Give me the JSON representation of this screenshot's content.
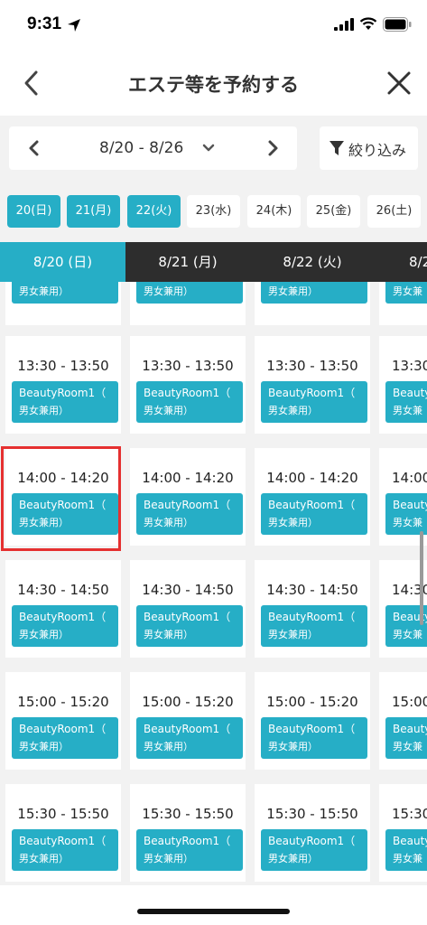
{
  "status_bar": {
    "time": "9:31"
  },
  "header": {
    "title": "エステ等を予約する"
  },
  "week_nav": {
    "range": "8/20 - 8/26"
  },
  "filter": {
    "label": "絞り込み"
  },
  "day_chips": [
    {
      "label": "20(日)",
      "selected": true
    },
    {
      "label": "21(月)",
      "selected": true
    },
    {
      "label": "22(火)",
      "selected": true
    },
    {
      "label": "23(水)",
      "selected": false
    },
    {
      "label": "24(木)",
      "selected": false
    },
    {
      "label": "25(金)",
      "selected": false
    },
    {
      "label": "26(土)",
      "selected": false
    }
  ],
  "columns": [
    {
      "label": "8/20 (日)",
      "active": true
    },
    {
      "label": "8/21 (月)",
      "active": false
    },
    {
      "label": "8/22 (火)",
      "active": false
    },
    {
      "label": "8/2",
      "active": false
    }
  ],
  "room": {
    "line1": "BeautyRoom1（",
    "line2": "男女兼用）"
  },
  "slots": [
    {
      "time": "13:30 - 13:50"
    },
    {
      "time": "14:00 - 14:20"
    },
    {
      "time": "14:30 - 14:50"
    },
    {
      "time": "15:00 - 15:20"
    },
    {
      "time": "15:30 - 15:50"
    }
  ],
  "partial_slots": [
    "13:30",
    "14:00",
    "14:30",
    "15:00",
    "15:30"
  ],
  "partial_room": {
    "line1": "Beauty",
    "line2": "男女兼"
  },
  "accent_color": "#26aec6",
  "highlight_color": "#e53030"
}
